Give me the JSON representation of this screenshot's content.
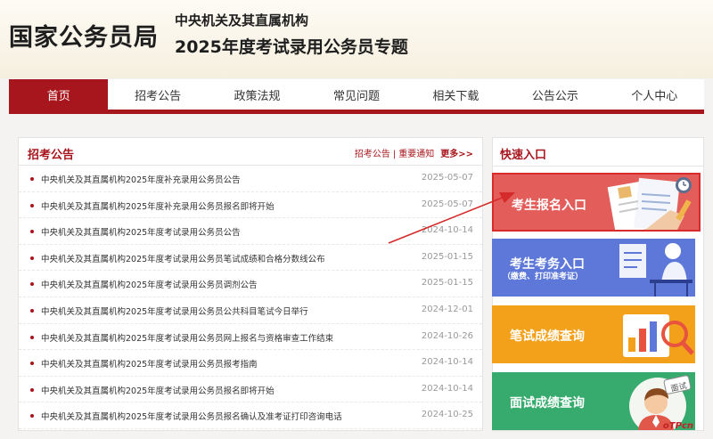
{
  "header": {
    "site_title": "国家公务员局",
    "subtitle_line1": "中央机关及其直属机构",
    "subtitle_line2": "2025年度考试录用公务员专题"
  },
  "nav": {
    "items": [
      {
        "label": "首页",
        "active": true
      },
      {
        "label": "招考公告",
        "active": false
      },
      {
        "label": "政策法规",
        "active": false
      },
      {
        "label": "常见问题",
        "active": false
      },
      {
        "label": "相关下载",
        "active": false
      },
      {
        "label": "公告公示",
        "active": false
      },
      {
        "label": "个人中心",
        "active": false
      }
    ]
  },
  "announcements": {
    "title": "招考公告",
    "link1": "招考公告",
    "separator": "|",
    "link2": "重要通知",
    "more": "更多>>",
    "items": [
      {
        "title": "中央机关及其直属机构2025年度补充录用公务员公告",
        "date": "2025-05-07"
      },
      {
        "title": "中央机关及其直属机构2025年度补充录用公务员报名即将开始",
        "date": "2025-05-07"
      },
      {
        "title": "中央机关及其直属机构2025年度考试录用公务员公告",
        "date": "2024-10-14"
      },
      {
        "title": "中央机关及其直属机构2025年度考试录用公务员笔试成绩和合格分数线公布",
        "date": "2025-01-15"
      },
      {
        "title": "中央机关及其直属机构2025年度考试录用公务员调剂公告",
        "date": "2025-01-15"
      },
      {
        "title": "中央机关及其直属机构2025年度考试录用公务员公共科目笔试今日举行",
        "date": "2024-12-01"
      },
      {
        "title": "中央机关及其直属机构2025年度考试录用公务员网上报名与资格审查工作结束",
        "date": "2024-10-26"
      },
      {
        "title": "中央机关及其直属机构2025年度考试录用公务员报考指南",
        "date": "2024-10-14"
      },
      {
        "title": "中央机关及其直属机构2025年度考试录用公务员报名即将开始",
        "date": "2024-10-14"
      },
      {
        "title": "中央机关及其直属机构2025年度考试录用公务员报名确认及准考证打印咨询电话",
        "date": "2024-10-25"
      }
    ]
  },
  "quick": {
    "title": "快速入口",
    "register": "考生报名入口",
    "exam_affairs": "考生考务入口",
    "exam_affairs_sub": "（缴费、打印准考证）",
    "written_score": "笔试成绩查询",
    "interview_score": "面试成绩查询",
    "interview_badge": "面试"
  },
  "watermark": "oTPcn",
  "colors": {
    "brand_red": "#a7161c",
    "register_bg": "#e35d5a",
    "exam_affairs_bg": "#5d78d8",
    "written_score_bg": "#f3a11a",
    "interview_score_bg": "#36ab6d",
    "arrow": "#d42a2a"
  }
}
